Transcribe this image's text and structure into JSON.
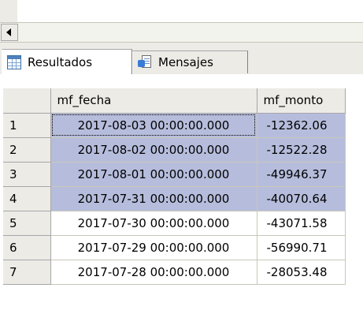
{
  "tabs": {
    "results_label": "Resultados",
    "messages_label": "Mensajes"
  },
  "grid": {
    "columns": [
      "",
      "mf_fecha",
      "mf_monto"
    ],
    "rows": [
      {
        "n": "1",
        "fecha": "2017-08-03 00:00:00.000",
        "monto": "-12362.06",
        "selected": true
      },
      {
        "n": "2",
        "fecha": "2017-08-02 00:00:00.000",
        "monto": "-12522.28",
        "selected": true
      },
      {
        "n": "3",
        "fecha": "2017-08-01 00:00:00.000",
        "monto": "-49946.37",
        "selected": true
      },
      {
        "n": "4",
        "fecha": "2017-07-31 00:00:00.000",
        "monto": "-40070.64",
        "selected": true
      },
      {
        "n": "5",
        "fecha": "2017-07-30 00:00:00.000",
        "monto": "-43071.58",
        "selected": false
      },
      {
        "n": "6",
        "fecha": "2017-07-29 00:00:00.000",
        "monto": "-56990.71",
        "selected": false
      },
      {
        "n": "7",
        "fecha": "2017-07-28 00:00:00.000",
        "monto": "-28053.48",
        "selected": false
      }
    ]
  },
  "colors": {
    "selection": "#b6bddc",
    "chrome": "#ecebe6"
  }
}
